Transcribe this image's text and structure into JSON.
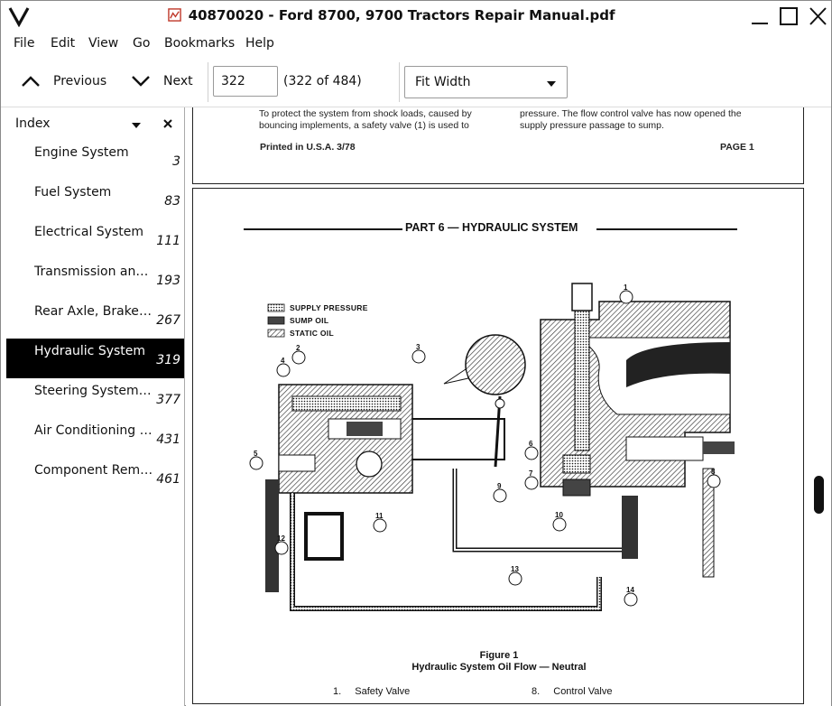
{
  "window": {
    "title": "40870020 - Ford 8700, 9700 Tractors Repair Manual.pdf"
  },
  "menu": [
    "File",
    "Edit",
    "View",
    "Go",
    "Bookmarks",
    "Help"
  ],
  "toolbar": {
    "previous_label": "Previous",
    "next_label": "Next",
    "page_value": "322",
    "page_count": "(322 of 484)",
    "zoom_value": "Fit Width"
  },
  "sidebar": {
    "title": "Index",
    "items": [
      {
        "label": "Engine System",
        "page": "3"
      },
      {
        "label": "Fuel System",
        "page": "83"
      },
      {
        "label": "Electrical System",
        "page": "111"
      },
      {
        "label": "Transmission and ...",
        "page": "193"
      },
      {
        "label": "Rear Axle, Brakes, ...",
        "page": "267"
      },
      {
        "label": "Hydraulic System",
        "page": "319",
        "active": true
      },
      {
        "label": "Steering System, ...",
        "page": "377"
      },
      {
        "label": "Air Conditioning a...",
        "page": "431"
      },
      {
        "label": "Component Remo...",
        "page": "461"
      }
    ]
  },
  "document": {
    "page1": {
      "left_line1": "To protect the system from shock loads, caused by",
      "left_line2": "bouncing implements, a safety valve (1) is used to",
      "right_line1": "pressure. The flow control valve has now opened the",
      "right_line2": "supply pressure passage to sump.",
      "footer_left": "Printed in U.S.A. 3/78",
      "footer_right": "PAGE 1"
    },
    "page2": {
      "part_title": "PART 6 — HYDRAULIC SYSTEM",
      "legend": [
        "SUPPLY PRESSURE",
        "SUMP OIL",
        "STATIC OIL"
      ],
      "callouts": [
        "1",
        "2",
        "3",
        "4",
        "5",
        "6",
        "7",
        "8",
        "9",
        "10",
        "11",
        "12",
        "13",
        "14"
      ],
      "figure_number": "Figure 1",
      "figure_title": "Hydraulic System Oil Flow — Neutral",
      "list": [
        {
          "num": "1.",
          "text": "Safety Valve"
        },
        {
          "num": "8.",
          "text": "Control Valve"
        }
      ]
    }
  },
  "colors": {
    "active_bg": "#000000",
    "active_fg": "#ffffff",
    "pdf_icon": "#c0392b"
  }
}
